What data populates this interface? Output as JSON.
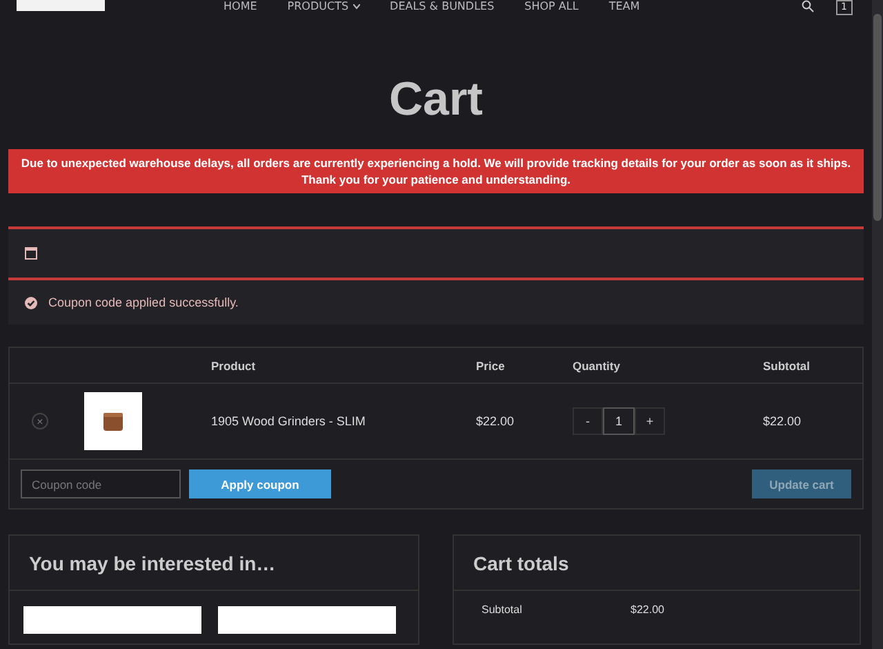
{
  "nav": {
    "items": [
      {
        "label": "HOME",
        "has_caret": false
      },
      {
        "label": "PRODUCTS",
        "has_caret": true
      },
      {
        "label": "DEALS & BUNDLES",
        "has_caret": false
      },
      {
        "label": "SHOP ALL",
        "has_caret": false
      },
      {
        "label": "TEAM",
        "has_caret": false
      }
    ],
    "cart_count": "1"
  },
  "title": "Cart",
  "alert": "Due to unexpected warehouse delays, all orders are currently experiencing a hold. We will provide tracking details for your order as soon as it ships. Thank you for your patience and understanding.",
  "notice": "Coupon code applied successfully.",
  "table": {
    "columns": [
      "Product",
      "Price",
      "Quantity",
      "Subtotal"
    ],
    "rows": [
      {
        "product": "1905 Wood Grinders - SLIM",
        "price": "$22.00",
        "quantity": "1",
        "subtotal": "$22.00",
        "remove": "×",
        "minus": "-",
        "plus": "+"
      }
    ]
  },
  "coupon": {
    "placeholder": "Coupon code",
    "apply": "Apply coupon",
    "update": "Update cart",
    "update_disabled": true
  },
  "interested": {
    "title": "You may be interested in…"
  },
  "totals": {
    "title": "Cart totals",
    "rows": [
      {
        "label": "Subtotal",
        "value": "$22.00"
      }
    ]
  }
}
